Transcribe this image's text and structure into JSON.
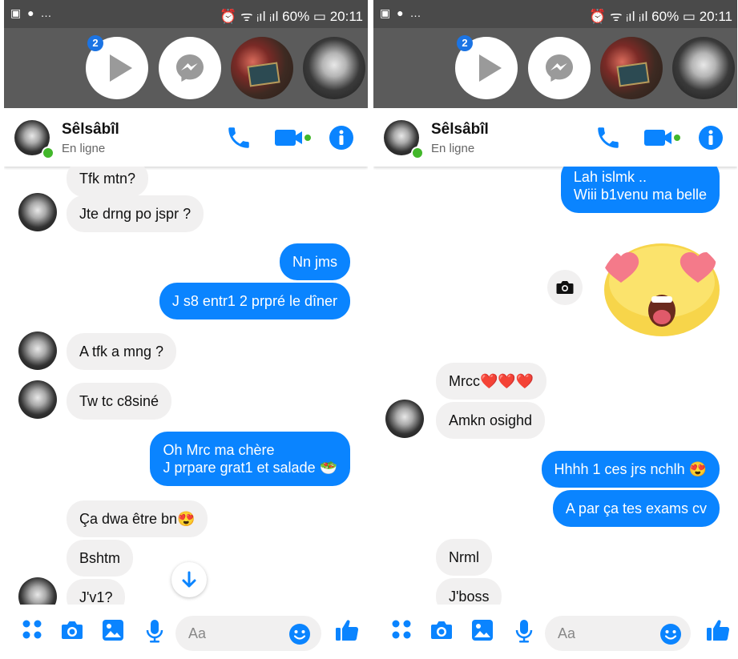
{
  "status": {
    "left_icons": "▣ ● …",
    "right_text": "⏰ ᯤ ᵢıl ᵢıl 60% ▭ 20:11"
  },
  "bubbles": {
    "badge_count": "2"
  },
  "header": {
    "name": "Sêlsâbîl",
    "status": "En ligne"
  },
  "left_chat": [
    {
      "text": "Tfk mtn?"
    },
    {
      "text": "Jte drng po jspr ?"
    },
    {
      "text": "Nn jms"
    },
    {
      "text": "J s8 entr1 2 prpré le dîner"
    },
    {
      "text": "A tfk a mng ?"
    },
    {
      "text": "Tw tc c8siné"
    },
    {
      "text": "Oh Mrc ma chère\nJ prpare grat1 et salade 🥗"
    },
    {
      "text": "Ça dwa être bn😍"
    },
    {
      "text": "Bshtm"
    },
    {
      "text": "J'v1?"
    }
  ],
  "right_chat": [
    {
      "text": "Lah islmk ..\nWiii b1venu ma belle"
    },
    {
      "text": "Mrcc❤️❤️❤️"
    },
    {
      "text": "Amkn osighd"
    },
    {
      "text": "Hhhh 1 ces jrs nchlh 😍"
    },
    {
      "text": "A par ça tes exams cv"
    },
    {
      "text": "Nrml"
    },
    {
      "text": "J'boss"
    }
  ],
  "composer": {
    "placeholder": "Aa"
  },
  "colors": {
    "accent": "#0a84ff",
    "incoming_bg": "#f1f0f0",
    "online": "#42b72a",
    "badge": "#1b74e4"
  }
}
